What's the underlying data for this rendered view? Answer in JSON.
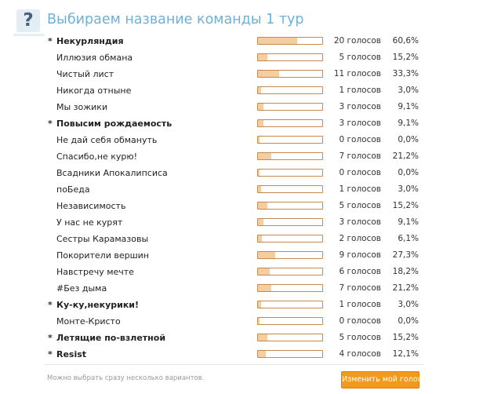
{
  "poll": {
    "title": "Выбираем название команды 1 тур",
    "icon": "question-mark-icon",
    "marker": "*",
    "note": "Можно выбрать сразу несколько вариантов.",
    "change_vote_label": "Изменить мой голос",
    "accent_color": "#6fb0d8",
    "bar_fill_color": "#f4cda1",
    "bar_border_color": "#c5894a",
    "button_color": "#f39a1e",
    "options": [
      {
        "label": "Некурляндия",
        "votes": "20 голосов",
        "percent": "60,6%",
        "share": 0.606,
        "chosen": true
      },
      {
        "label": "Иллюзия обмана",
        "votes": "5 голосов",
        "percent": "15,2%",
        "share": 0.152,
        "chosen": false
      },
      {
        "label": "Чистый лист",
        "votes": "11 голосов",
        "percent": "33,3%",
        "share": 0.333,
        "chosen": false
      },
      {
        "label": "Никогда отныне",
        "votes": "1 голосов",
        "percent": "3,0%",
        "share": 0.03,
        "chosen": false
      },
      {
        "label": "Мы зожики",
        "votes": "3 голосов",
        "percent": "9,1%",
        "share": 0.091,
        "chosen": false
      },
      {
        "label": "Повысим рождаемость",
        "votes": "3 голосов",
        "percent": "9,1%",
        "share": 0.091,
        "chosen": true
      },
      {
        "label": "Не дай себя обмануть",
        "votes": "0 голосов",
        "percent": "0,0%",
        "share": 0.0,
        "chosen": false
      },
      {
        "label": "Спасибо,не курю!",
        "votes": "7 голосов",
        "percent": "21,2%",
        "share": 0.212,
        "chosen": false
      },
      {
        "label": "Всадники Апокалипсиса",
        "votes": "0 голосов",
        "percent": "0,0%",
        "share": 0.0,
        "chosen": false
      },
      {
        "label": "поБеда",
        "votes": "1 голосов",
        "percent": "3,0%",
        "share": 0.03,
        "chosen": false
      },
      {
        "label": "Независимость",
        "votes": "5 голосов",
        "percent": "15,2%",
        "share": 0.152,
        "chosen": false
      },
      {
        "label": "У нас не курят",
        "votes": "3 голосов",
        "percent": "9,1%",
        "share": 0.091,
        "chosen": false
      },
      {
        "label": "Сестры Карамазовы",
        "votes": "2 голосов",
        "percent": "6,1%",
        "share": 0.061,
        "chosen": false
      },
      {
        "label": "Покорители вершин",
        "votes": "9 голосов",
        "percent": "27,3%",
        "share": 0.273,
        "chosen": false
      },
      {
        "label": "Навстречу мечте",
        "votes": "6 голосов",
        "percent": "18,2%",
        "share": 0.182,
        "chosen": false
      },
      {
        "label": "#Без дыма",
        "votes": "7 голосов",
        "percent": "21,2%",
        "share": 0.212,
        "chosen": false
      },
      {
        "label": "Ку-ку,некурики!",
        "votes": "1 голосов",
        "percent": "3,0%",
        "share": 0.03,
        "chosen": true
      },
      {
        "label": "Монте-Кристо",
        "votes": "0 голосов",
        "percent": "0,0%",
        "share": 0.0,
        "chosen": false
      },
      {
        "label": "Летящие по-взлетной",
        "votes": "5 голосов",
        "percent": "15,2%",
        "share": 0.152,
        "chosen": true
      },
      {
        "label": "Resist",
        "votes": "4 голосов",
        "percent": "12,1%",
        "share": 0.121,
        "chosen": true
      }
    ]
  }
}
